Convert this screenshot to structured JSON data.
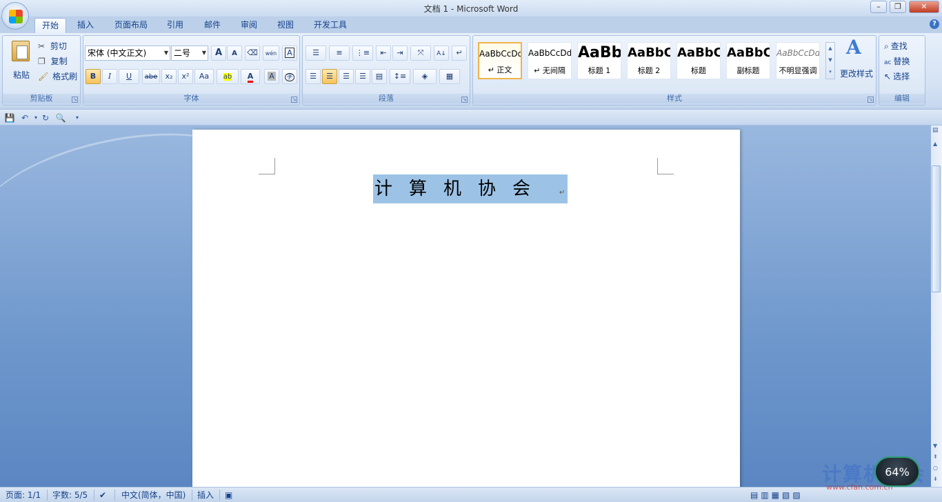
{
  "window": {
    "title": "文档 1 - Microsoft Word",
    "minimize": "–",
    "maximize": "❐",
    "close": "✕"
  },
  "tabs": [
    {
      "label": "开始",
      "active": true
    },
    {
      "label": "插入"
    },
    {
      "label": "页面布局"
    },
    {
      "label": "引用"
    },
    {
      "label": "邮件"
    },
    {
      "label": "审阅"
    },
    {
      "label": "视图"
    },
    {
      "label": "开发工具"
    }
  ],
  "clipboard": {
    "paste": "粘贴",
    "cut": "剪切",
    "copy": "复制",
    "format_painter": "格式刷",
    "label": "剪贴板"
  },
  "font": {
    "name": "宋体 (中文正文)",
    "size": "二号",
    "grow": "A",
    "shrink": "A",
    "bold": "B",
    "italic": "I",
    "underline": "U",
    "strike": "abe",
    "subscript": "x₂",
    "superscript": "x²",
    "change_case": "Aa",
    "highlight": "ab",
    "font_color": "A",
    "shading": "A",
    "enclose": "字",
    "phonetic": "wén",
    "clear": "A",
    "label": "字体"
  },
  "paragraph": {
    "label": "段落"
  },
  "styles": {
    "tiles": [
      {
        "sample": "AaBbCcDd",
        "name": "↵ 正文",
        "selected": true
      },
      {
        "sample": "AaBbCcDd",
        "name": "↵ 无间隔"
      },
      {
        "sample": "AaBb",
        "name": "标题 1"
      },
      {
        "sample": "AaBbC",
        "name": "标题 2"
      },
      {
        "sample": "AaBbC",
        "name": "标题"
      },
      {
        "sample": "AaBbC",
        "name": "副标题"
      },
      {
        "sample": "AaBbCcDd",
        "name": "不明显强调"
      }
    ],
    "change_styles": "更改样式",
    "label": "样式"
  },
  "editing": {
    "find": "查找",
    "replace": "替换",
    "select": "选择",
    "label": "编辑"
  },
  "document": {
    "text": "计算机协会",
    "para_mark": "↵"
  },
  "status": {
    "page": "页面: 1/1",
    "words": "字数: 5/5",
    "language": "中文(简体，中国)",
    "mode": "插入"
  },
  "watermark": {
    "text": "计算机协会",
    "url": "www.cfan.com.cn",
    "gauge": "64%"
  }
}
